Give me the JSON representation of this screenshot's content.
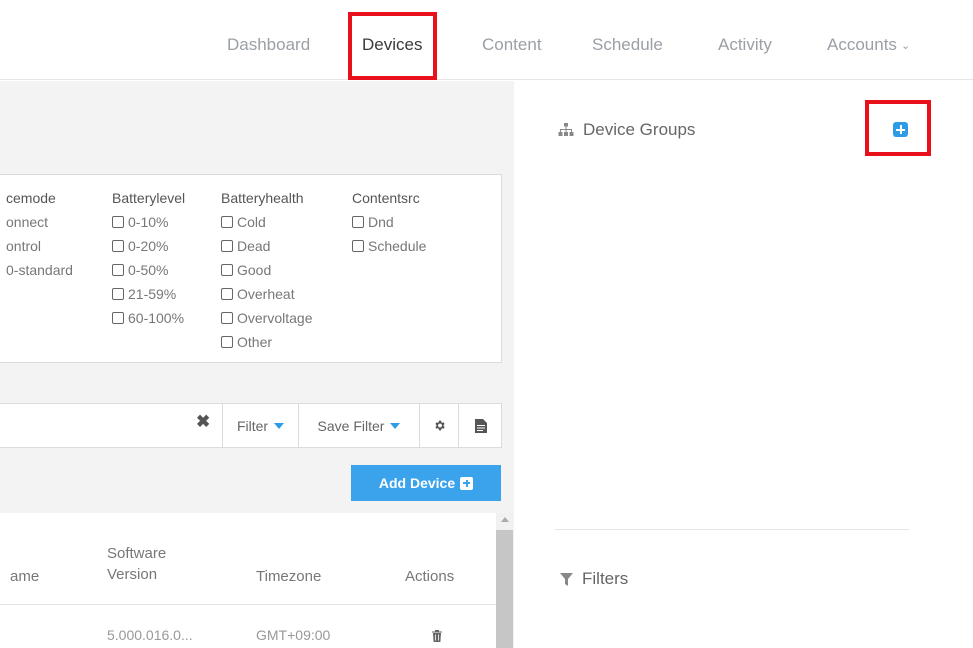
{
  "nav": {
    "items": [
      {
        "label": "Dashboard"
      },
      {
        "label": "Devices"
      },
      {
        "label": "Content"
      },
      {
        "label": "Schedule"
      },
      {
        "label": "Activity"
      },
      {
        "label": "Accounts"
      }
    ],
    "active": "Devices",
    "accounts_icon": "chevron-down-icon"
  },
  "filters_panel": {
    "columns": [
      {
        "header": "cemode",
        "options": [
          "onnect",
          "ontrol",
          "0-standard"
        ],
        "partial": true
      },
      {
        "header": "Batterylevel",
        "options": [
          "0-10%",
          "0-20%",
          "0-50%",
          "21-59%",
          "60-100%"
        ]
      },
      {
        "header": "Batteryhealth",
        "options": [
          "Cold",
          "Dead",
          "Good",
          "Overheat",
          "Overvoltage",
          "Other"
        ]
      },
      {
        "header": "Contentsrc",
        "options": [
          "Dnd",
          "Schedule"
        ]
      }
    ]
  },
  "searchbar": {
    "clear_icon": "close-icon",
    "filter_label": "Filter",
    "save_filter_label": "Save Filter",
    "settings_icon": "gear-icon",
    "export_icon": "document-icon"
  },
  "add_device": {
    "label": "Add Device",
    "icon": "plus-square-icon"
  },
  "table": {
    "headers": {
      "name": "ame",
      "software_l1": "Software",
      "software_l2": "Version",
      "timezone": "Timezone",
      "actions": "Actions"
    },
    "rows": [
      {
        "software_version": "5.000.016.0...",
        "timezone": "GMT+09:00",
        "action_icon": "trash-icon"
      }
    ]
  },
  "right_panel": {
    "device_groups": {
      "title": "Device Groups",
      "icon": "sitemap-icon",
      "add_icon": "plus-square-icon"
    },
    "filters": {
      "title": "Filters",
      "icon": "funnel-icon"
    }
  },
  "colors": {
    "accent": "#3aa3ec",
    "highlight": "#e8101a",
    "panel_bg": "#f3f3f3"
  }
}
